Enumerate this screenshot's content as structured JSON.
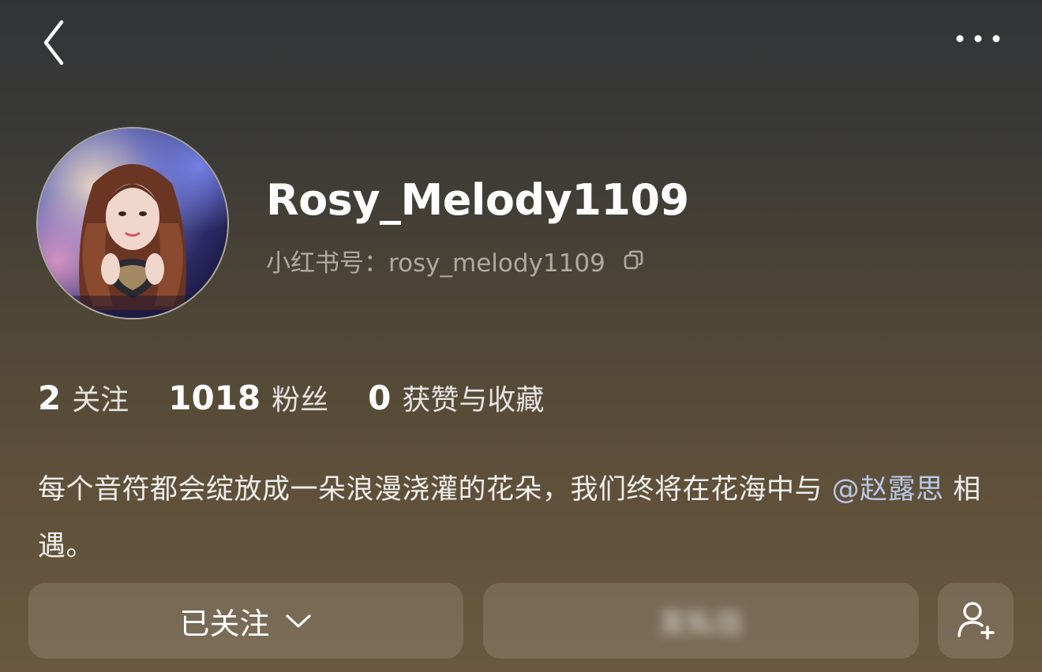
{
  "profile": {
    "username": "Rosy_Melody1109",
    "xhs_id": "小红书号：rosy_melody1109"
  },
  "stats": [
    {
      "value": "2",
      "label": "关注"
    },
    {
      "value": "1018",
      "label": "粉丝"
    },
    {
      "value": "0",
      "label": "获赞与收藏"
    }
  ],
  "bio": {
    "text_before": "每个音符都会绽放成一朵浪漫浇灌的花朵，我们终将在花海中与 ",
    "mention": "@赵露思",
    "text_after": " 相遇。"
  },
  "actions": {
    "follow_label": "已关注",
    "message_label": "发私信"
  },
  "icons": {
    "back": "chevron-left-icon",
    "more": "more-dots-icon",
    "copy": "copy-icon",
    "dropdown": "chevron-down-icon",
    "add_friend": "add-user-icon"
  },
  "colors": {
    "mention": "#b7c9e6",
    "button_bg": "rgba(255,255,255,0.12)"
  }
}
